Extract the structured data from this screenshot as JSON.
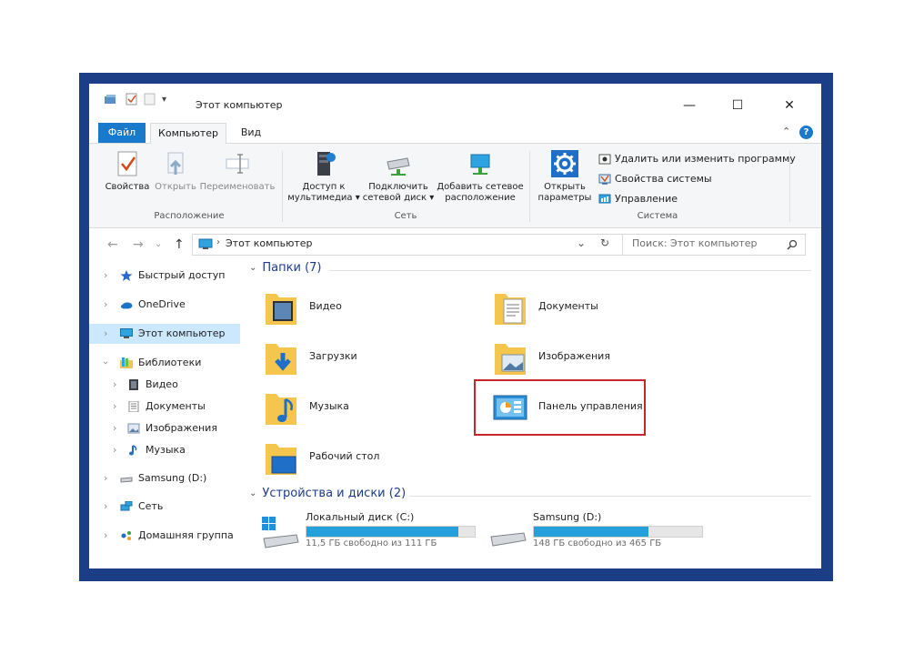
{
  "window": {
    "title": "Этот компьютер",
    "controls": {
      "minimize": "—",
      "maximize": "☐",
      "close": "✕"
    }
  },
  "tabs": [
    {
      "label": "Файл",
      "active": false
    },
    {
      "label": "Компьютер",
      "active": true
    },
    {
      "label": "Вид",
      "active": false
    }
  ],
  "ribbon": {
    "location_group": {
      "label": "Расположение",
      "buttons": [
        {
          "label": "Свойства",
          "disabled": false
        },
        {
          "label": "Открыть",
          "disabled": true
        },
        {
          "label": "Переименовать",
          "disabled": true
        }
      ]
    },
    "network_group": {
      "label": "Сеть",
      "buttons": [
        {
          "line1": "Доступ к",
          "line2": "мультимедиа ▾"
        },
        {
          "line1": "Подключить",
          "line2": "сетевой диск ▾"
        },
        {
          "line1": "Добавить сетевое",
          "line2": "расположение"
        }
      ]
    },
    "system_group": {
      "label": "Система",
      "open_settings": {
        "line1": "Открыть",
        "line2": "параметры"
      },
      "items": [
        "Удалить или изменить программу",
        "Свойства системы",
        "Управление"
      ]
    }
  },
  "address_bar": {
    "path": "Этот компьютер",
    "search_placeholder": "Поиск: Этот компьютер"
  },
  "nav_pane": {
    "items": [
      {
        "label": "Быстрый доступ",
        "icon": "star-icon",
        "expanded": false
      },
      {
        "label": "OneDrive",
        "icon": "cloud-icon",
        "expanded": false
      },
      {
        "label": "Этот компьютер",
        "icon": "computer-icon",
        "expanded": false,
        "selected": true
      },
      {
        "label": "Библиотеки",
        "icon": "libraries-icon",
        "expanded": true
      },
      {
        "label": "Видео",
        "icon": "video-icon",
        "child": true
      },
      {
        "label": "Документы",
        "icon": "documents-icon",
        "child": true
      },
      {
        "label": "Изображения",
        "icon": "images-icon",
        "child": true
      },
      {
        "label": "Музыка",
        "icon": "music-icon",
        "child": true
      },
      {
        "label": "Samsung (D:)",
        "icon": "drive-icon",
        "expanded": false
      },
      {
        "label": "Сеть",
        "icon": "network-icon",
        "expanded": false
      },
      {
        "label": "Домашняя группа",
        "icon": "homegroup-icon",
        "expanded": false
      }
    ]
  },
  "folders": {
    "header": "Папки (7)",
    "items": [
      {
        "label": "Видео",
        "icon": "video-folder-icon"
      },
      {
        "label": "Документы",
        "icon": "documents-folder-icon"
      },
      {
        "label": "Загрузки",
        "icon": "downloads-folder-icon"
      },
      {
        "label": "Изображения",
        "icon": "images-folder-icon"
      },
      {
        "label": "Музыка",
        "icon": "music-folder-icon"
      },
      {
        "label": "Панель управления",
        "icon": "control-panel-icon"
      },
      {
        "label": "Рабочий стол",
        "icon": "desktop-folder-icon"
      }
    ]
  },
  "devices": {
    "header": "Устройства и диски (2)",
    "items": [
      {
        "name": "Локальный диск (C:)",
        "free": "11,5 ГБ свободно из 111 ГБ",
        "used_fraction": 0.9
      },
      {
        "name": "Samsung (D:)",
        "free": "148 ГБ свободно из 465 ГБ",
        "used_fraction": 0.68
      }
    ]
  },
  "colors": {
    "accent": "#1979ca",
    "frame": "#1b3e86",
    "selection": "#cce8ff",
    "highlight_box": "#c5252b",
    "drive_fill": "#26a0da",
    "section_header": "#1e3a8a"
  }
}
